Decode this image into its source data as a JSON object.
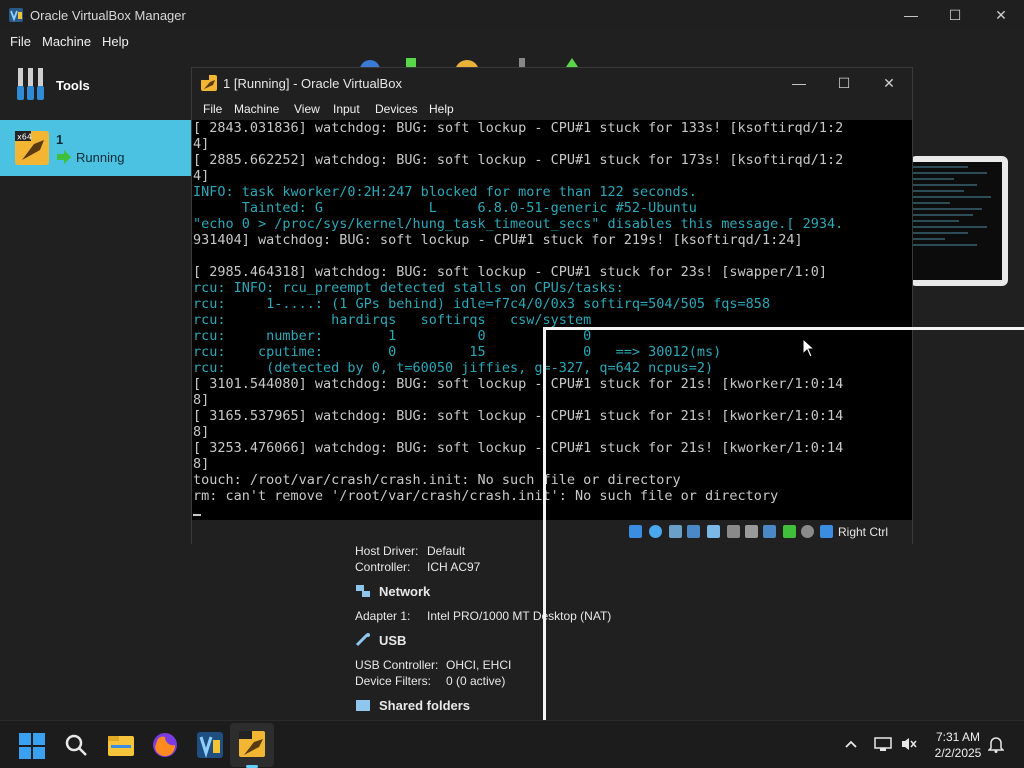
{
  "manager": {
    "title": "Oracle VirtualBox Manager",
    "menu": [
      "File",
      "Machine",
      "Help"
    ],
    "tools_label": "Tools",
    "vm": {
      "name": "1",
      "state": "Running",
      "os_badge": "x64"
    }
  },
  "details": {
    "audio": [
      {
        "key": "Host Driver:",
        "value": "Default"
      },
      {
        "key": "Controller:",
        "value": "ICH AC97"
      }
    ],
    "network_title": "Network",
    "network": [
      {
        "key": "Adapter 1:",
        "value": "Intel PRO/1000 MT Desktop (NAT)"
      }
    ],
    "usb_title": "USB",
    "usb": [
      {
        "key": "USB Controller:",
        "value": "OHCI, EHCI"
      },
      {
        "key": "Device Filters:",
        "value": "0 (0 active)"
      }
    ],
    "shared_title": "Shared folders"
  },
  "vmwindow": {
    "title": "1 [Running] - Oracle VirtualBox",
    "menu": [
      "File",
      "Machine",
      "View",
      "Input",
      "Devices",
      "Help"
    ],
    "host_key": "Right Ctrl",
    "console_lines": [
      {
        "text": "[ 2843.031836] watchdog: BUG: soft lockup - CPU#1 stuck for 133s! [ksoftirqd/1:2",
        "color": "w"
      },
      {
        "text": "4]",
        "color": "w"
      },
      {
        "text": "[ 2885.662252] watchdog: BUG: soft lockup - CPU#1 stuck for 173s! [ksoftirqd/1:2",
        "color": "w"
      },
      {
        "text": "4]",
        "color": "w"
      },
      {
        "text": "INFO: task kworker/0:2H:247 blocked for more than 122 seconds.",
        "color": "c"
      },
      {
        "text": "      Tainted: G             L     6.8.0-51-generic #52-Ubuntu",
        "color": "c"
      },
      {
        "text": "\"echo 0 > /proc/sys/kernel/hung_task_timeout_secs\" disables this message.[ 2934.",
        "color": "c"
      },
      {
        "text": "931404] watchdog: BUG: soft lockup - CPU#1 stuck for 219s! [ksoftirqd/1:24]",
        "color": "w"
      },
      {
        "text": "",
        "color": "w"
      },
      {
        "text": "[ 2985.464318] watchdog: BUG: soft lockup - CPU#1 stuck for 23s! [swapper/1:0]",
        "color": "w"
      },
      {
        "text": "rcu: INFO: rcu_preempt detected stalls on CPUs/tasks:",
        "color": "c"
      },
      {
        "text": "rcu:     1-....: (1 GPs behind) idle=f7c4/0/0x3 softirq=504/505 fqs=858",
        "color": "c"
      },
      {
        "text": "rcu:             hardirqs   softirqs   csw/system",
        "color": "c"
      },
      {
        "text": "rcu:     number:        1          0            0",
        "color": "c"
      },
      {
        "text": "rcu:    cputime:        0         15            0   ==> 30012(ms)",
        "color": "c"
      },
      {
        "text": "rcu:     (detected by 0, t=60050 jiffies, g=-327, q=642 ncpus=2)",
        "color": "c"
      },
      {
        "text": "[ 3101.544080] watchdog: BUG: soft lockup - CPU#1 stuck for 21s! [kworker/1:0:14",
        "color": "w"
      },
      {
        "text": "8]",
        "color": "w"
      },
      {
        "text": "[ 3165.537965] watchdog: BUG: soft lockup - CPU#1 stuck for 21s! [kworker/1:0:14",
        "color": "w"
      },
      {
        "text": "8]",
        "color": "w"
      },
      {
        "text": "[ 3253.476066] watchdog: BUG: soft lockup - CPU#1 stuck for 21s! [kworker/1:0:14",
        "color": "w"
      },
      {
        "text": "8]",
        "color": "w"
      },
      {
        "text": "touch: /root/var/crash/crash.init: No such file or directory",
        "color": "w"
      },
      {
        "text": "rm: can't remove '/root/var/crash/crash.init': No such file or directory",
        "color": "w"
      }
    ]
  },
  "taskbar": {
    "time": "7:31 AM",
    "date": "2/2/2025",
    "apps": [
      "start-icon",
      "search-icon",
      "file-explorer-icon",
      "firefox-icon",
      "virtualbox-icon",
      "running-vm-icon"
    ]
  },
  "colors": {
    "accent": "#4cc2e2",
    "console_cyan": "#2aa8b8",
    "console_text": "#c8c8c8"
  }
}
